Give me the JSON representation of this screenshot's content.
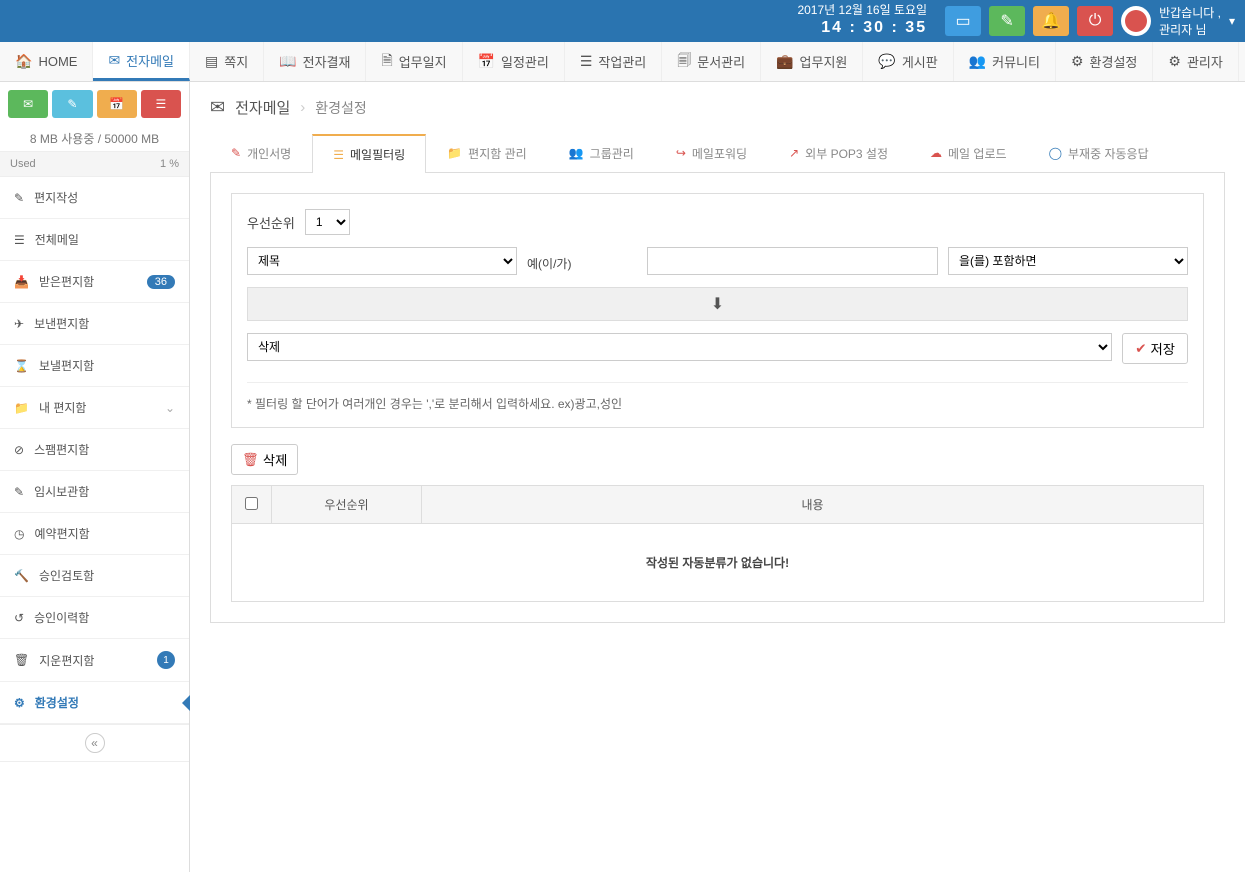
{
  "header": {
    "date": "2017년 12월 16일 토요일",
    "time": "14 : 30 : 35",
    "greeting": "반갑습니다 ,",
    "user": "관리자 님"
  },
  "topnav": [
    {
      "label": "HOME"
    },
    {
      "label": "전자메일"
    },
    {
      "label": "쪽지"
    },
    {
      "label": "전자결재"
    },
    {
      "label": "업무일지"
    },
    {
      "label": "일정관리"
    },
    {
      "label": "작업관리"
    },
    {
      "label": "문서관리"
    },
    {
      "label": "업무지원"
    },
    {
      "label": "게시판"
    },
    {
      "label": "커뮤니티"
    },
    {
      "label": "환경설정"
    },
    {
      "label": "관리자"
    }
  ],
  "sidebar": {
    "usage": "8 MB 사용중 / 50000 MB",
    "used_label": "Used",
    "used_pct": "1 %",
    "items": [
      {
        "label": "편지작성"
      },
      {
        "label": "전체메일"
      },
      {
        "label": "받은편지함",
        "badge": "36"
      },
      {
        "label": "보낸편지함"
      },
      {
        "label": "보낼편지함"
      },
      {
        "label": "내 편지함",
        "chev": true
      },
      {
        "label": "스팸편지함"
      },
      {
        "label": "임시보관함"
      },
      {
        "label": "예약편지함"
      },
      {
        "label": "승인검토함"
      },
      {
        "label": "승인이력함"
      },
      {
        "label": "지운편지함",
        "badge_circle": "1"
      },
      {
        "label": "환경설정",
        "active": true
      }
    ]
  },
  "crumb": {
    "main": "전자메일",
    "sub": "환경설정"
  },
  "tabs": [
    {
      "label": "개인서명"
    },
    {
      "label": "메일필터링"
    },
    {
      "label": "편지함 관리"
    },
    {
      "label": "그룹관리"
    },
    {
      "label": "메일포워딩"
    },
    {
      "label": "외부 POP3 설정"
    },
    {
      "label": "메일 업로드"
    },
    {
      "label": "부재중 자동응답"
    }
  ],
  "filter": {
    "priority_label": "우선순위",
    "priority_val": "1",
    "field_sel": "제목",
    "cond_text": "예(이/가)",
    "match_sel": "을(를) 포함하면",
    "action_sel": "삭제",
    "save_label": "저장",
    "note": "* 필터링 할 단어가 여러개인 경우는 ','로 분리해서 입력하세요. ex)광고,성인",
    "delete_btn": "삭제"
  },
  "table": {
    "col_priority": "우선순위",
    "col_content": "내용",
    "empty": "작성된 자동분류가 없습니다!"
  }
}
